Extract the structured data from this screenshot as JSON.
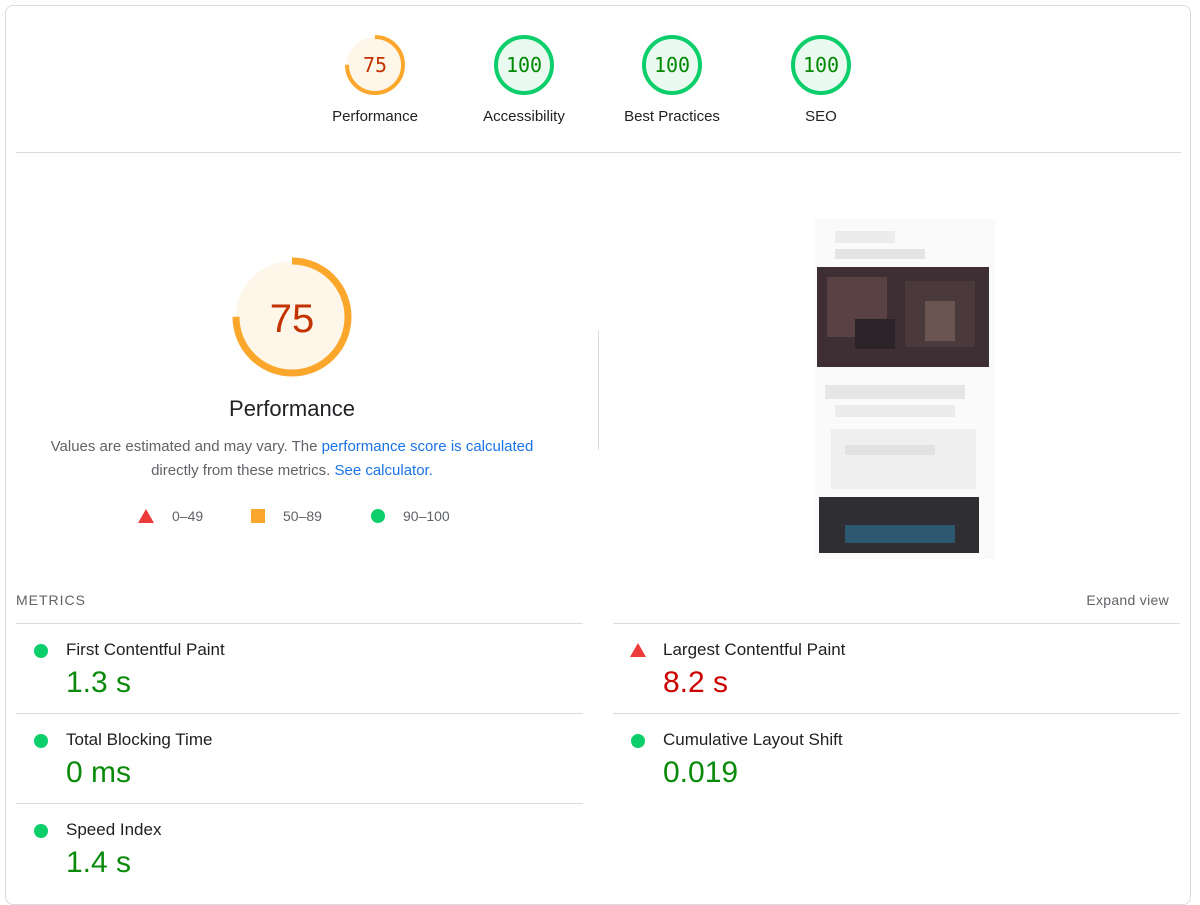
{
  "gauges": [
    {
      "label": "Performance",
      "score": "75",
      "value": 75,
      "color": "#fba72c",
      "bg": "#fff6ea",
      "text": "#c33300"
    },
    {
      "label": "Accessibility",
      "score": "100",
      "value": 100,
      "color": "#0cce6b",
      "bg": "#eafaf1",
      "text": "#008800"
    },
    {
      "label": "Best Practices",
      "score": "100",
      "value": 100,
      "color": "#0cce6b",
      "bg": "#eafaf1",
      "text": "#008800"
    },
    {
      "label": "SEO",
      "score": "100",
      "value": 100,
      "color": "#0cce6b",
      "bg": "#eafaf1",
      "text": "#008800"
    }
  ],
  "performance": {
    "score": "75",
    "value": 75,
    "title": "Performance",
    "desc_1": "Values are estimated and may vary. The ",
    "desc_link_1": "performance score is calculated",
    "desc_2": "directly from these metrics. ",
    "desc_link_2": "See calculator."
  },
  "legend": {
    "fail": "0–49",
    "average": "50–89",
    "pass": "90–100"
  },
  "metrics_header": {
    "title": "METRICS",
    "expand": "Expand view"
  },
  "metrics": {
    "fcp": {
      "name": "First Contentful Paint",
      "value": "1.3 s",
      "status": "pass"
    },
    "tbt": {
      "name": "Total Blocking Time",
      "value": "0 ms",
      "status": "pass"
    },
    "si": {
      "name": "Speed Index",
      "value": "1.4 s",
      "status": "pass"
    },
    "lcp": {
      "name": "Largest Contentful Paint",
      "value": "8.2 s",
      "status": "fail"
    },
    "cls": {
      "name": "Cumulative Layout Shift",
      "value": "0.019",
      "status": "pass"
    }
  },
  "colors": {
    "pass": "#0cce6b",
    "average": "#fba72c",
    "fail": "#eb3b3b",
    "link": "#1a73e8"
  }
}
